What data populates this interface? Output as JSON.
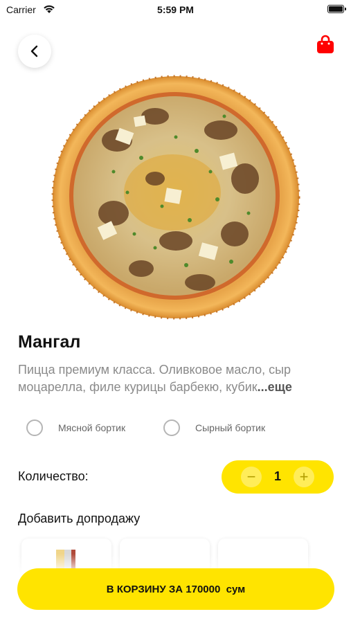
{
  "status_bar": {
    "carrier": "Carrier",
    "time": "5:59 PM",
    "wifi_icon": "wifi-icon",
    "battery_icon": "battery-icon"
  },
  "header": {
    "back_icon": "chevron-left-icon",
    "cart_icon": "shopping-bag-icon",
    "cart_color": "#ff0000"
  },
  "product": {
    "title": "Мангал",
    "description": "Пицца премиум класса. Оливковое масло, сыр моцарелла, филе курицы барбекю, кубик",
    "more_label": "...еще"
  },
  "options": [
    {
      "label": "Мясной бортик",
      "selected": false
    },
    {
      "label": "Сырный бортик",
      "selected": false
    }
  ],
  "quantity": {
    "label": "Количество:",
    "value": "1",
    "minus": "−",
    "plus": "+"
  },
  "upsell": {
    "title": "Добавить допродажу",
    "cards_visible": 3
  },
  "cart_button": {
    "label": "В КОРЗИНУ ЗА 170000  сум"
  },
  "colors": {
    "accent": "#ffe400",
    "text": "#111111",
    "muted": "#8a8a8a"
  }
}
